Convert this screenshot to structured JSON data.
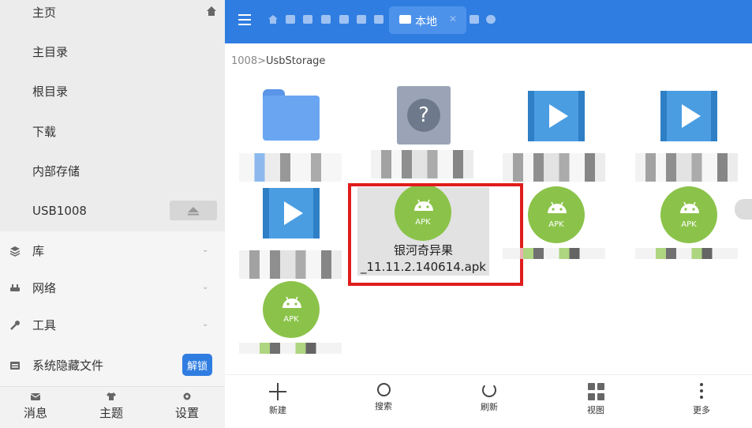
{
  "sidebar": {
    "items": [
      {
        "label": "主页"
      },
      {
        "label": "主目录"
      },
      {
        "label": "根目录"
      },
      {
        "label": "下载"
      },
      {
        "label": "内部存储"
      },
      {
        "label": "USB1008"
      }
    ],
    "sections": [
      {
        "label": "库"
      },
      {
        "label": "网络"
      },
      {
        "label": "工具"
      },
      {
        "label": "系统隐藏文件"
      }
    ],
    "unlock_label": "解锁",
    "bottom": [
      {
        "label": "消息"
      },
      {
        "label": "主题"
      },
      {
        "label": "设置"
      }
    ]
  },
  "topbar": {
    "active_tab": "本地"
  },
  "breadcrumb": {
    "parent": "1008",
    "separator": ">",
    "current": "UsbStorage"
  },
  "files": [
    {
      "type": "folder"
    },
    {
      "type": "unknown"
    },
    {
      "type": "video"
    },
    {
      "type": "video"
    },
    {
      "type": "video"
    },
    {
      "type": "apk",
      "name": "银河奇异果_11.11.2.140614.apk",
      "name_line1": "银河奇异果",
      "name_line2": "_11.11.2.140614.apk",
      "badge": "APK",
      "selected": true
    },
    {
      "type": "apk",
      "badge": "APK"
    },
    {
      "type": "apk",
      "badge": "APK"
    },
    {
      "type": "apk",
      "badge": "APK"
    }
  ],
  "toolbar": {
    "new_label": "新建",
    "search_label": "搜索",
    "refresh_label": "刷新",
    "view_label": "视图",
    "more_label": "更多"
  },
  "colors": {
    "accent": "#2f7de1",
    "apk_green": "#8bc34a",
    "highlight_red": "#e01c1c"
  }
}
